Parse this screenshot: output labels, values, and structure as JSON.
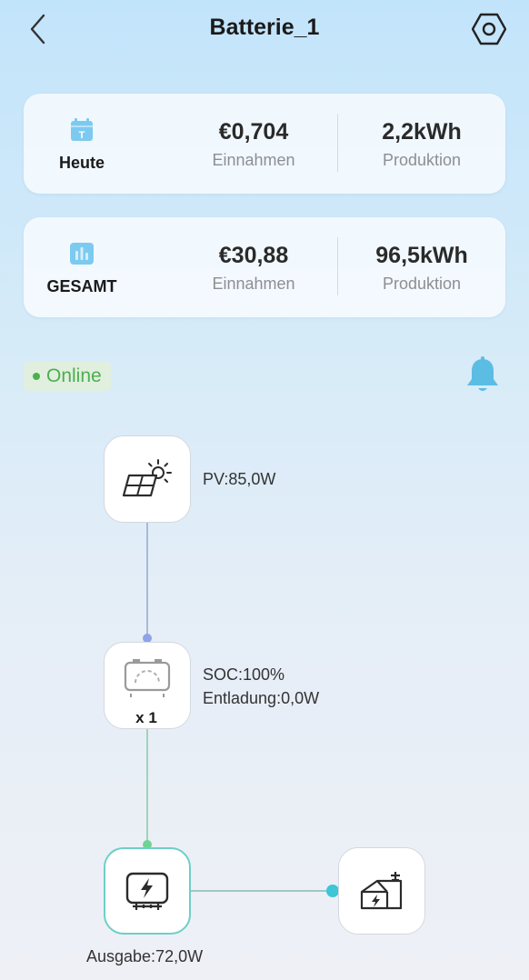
{
  "header": {
    "title": "Batterie_1"
  },
  "today": {
    "period": "Heute",
    "income_value": "€0,704",
    "income_label": "Einnahmen",
    "production_value": "2,2kWh",
    "production_label": "Produktion"
  },
  "total": {
    "period": "GESAMT",
    "income_value": "€30,88",
    "income_label": "Einnahmen",
    "production_value": "96,5kWh",
    "production_label": "Produktion"
  },
  "status": {
    "label": "Online"
  },
  "flow": {
    "pv": "PV:85,0W",
    "battery_soc": "SOC:100%",
    "battery_discharge": "Entladung:0,0W",
    "battery_count": "x 1",
    "output": "Ausgabe:72,0W"
  },
  "colors": {
    "accent": "#5bbde4",
    "online": "#4caf4f",
    "pv_line": "#a9b8dc",
    "battery_line": "#9ed4b9",
    "home_line": "#9cc8c6",
    "inverter_border": "#6ecfc7"
  },
  "icons": [
    "back-arrow-icon",
    "settings-hex-icon",
    "calendar-icon",
    "bar-chart-icon",
    "bell-icon",
    "solar-panel-icon",
    "battery-icon",
    "inverter-icon",
    "home-icon"
  ]
}
